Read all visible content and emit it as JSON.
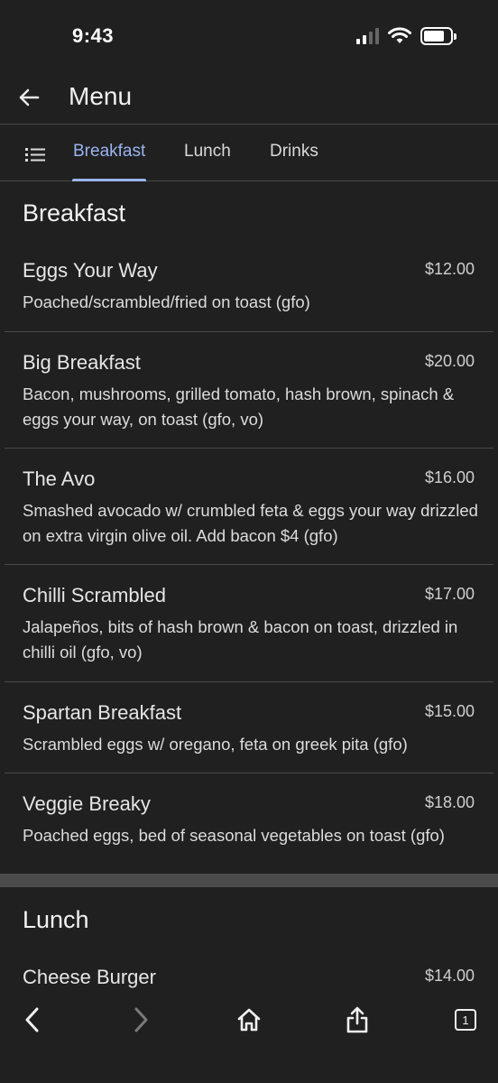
{
  "status_bar": {
    "time": "9:43"
  },
  "header": {
    "title": "Menu"
  },
  "tabs": [
    {
      "label": "Breakfast"
    },
    {
      "label": "Lunch"
    },
    {
      "label": "Drinks"
    }
  ],
  "sections": [
    {
      "title": "Breakfast",
      "items": [
        {
          "name": "Eggs Your Way",
          "price": "$12.00",
          "description": "Poached/scrambled/fried on toast (gfo)"
        },
        {
          "name": "Big Breakfast",
          "price": "$20.00",
          "description": "Bacon, mushrooms, grilled tomato, hash brown, spinach & eggs your way, on toast (gfo, vo)"
        },
        {
          "name": "The Avo",
          "price": "$16.00",
          "description": "Smashed avocado w/ crumbled feta & eggs your way drizzled on extra virgin olive oil. Add bacon $4 (gfo)"
        },
        {
          "name": "Chilli Scrambled",
          "price": "$17.00",
          "description": "Jalapeños, bits of hash brown & bacon on toast, drizzled in chilli oil (gfo, vo)"
        },
        {
          "name": "Spartan Breakfast",
          "price": "$15.00",
          "description": "Scrambled eggs w/ oregano, feta on greek pita (gfo)"
        },
        {
          "name": "Veggie Breaky",
          "price": "$18.00",
          "description": "Poached eggs, bed of seasonal vegetables on toast (gfo)"
        }
      ]
    },
    {
      "title": "Lunch",
      "items": [
        {
          "name": "Cheese Burger",
          "price": "$14.00"
        }
      ]
    }
  ],
  "bottom_bar": {
    "tab_count": "1"
  },
  "icons": {
    "back": "arrow-left-icon",
    "tab_list": "list-icon",
    "browser_back": "chevron-left-icon",
    "browser_forward": "chevron-right-icon",
    "home": "home-icon",
    "share": "share-icon",
    "tabs": "tabs-icon"
  },
  "colors": {
    "background": "#202020",
    "accent": "#9ab4ef",
    "divider": "#4a4a4a"
  }
}
